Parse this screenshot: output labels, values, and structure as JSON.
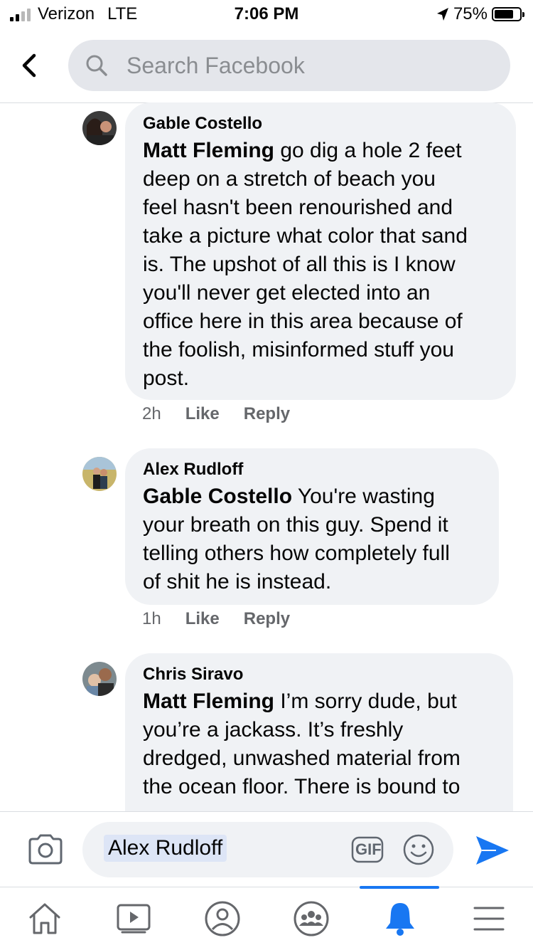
{
  "status_bar": {
    "carrier": "Verizon",
    "network": "LTE",
    "time": "7:06 PM",
    "battery": "75%",
    "battery_level": 0.75
  },
  "header": {
    "back_icon": "chevron-left-icon",
    "search_placeholder": "Search Facebook"
  },
  "comments": [
    {
      "author": "Gable Costello",
      "mention": "Matt Fleming",
      "text_lines": [
        " go dig a hole 2 feet",
        "deep on a stretch of beach you",
        "feel hasn't been renourished and",
        "take a picture what color that sand",
        "is.  The upshot of all this is I know",
        "you'll never get elected into an",
        "office here in this area because of",
        "the foolish, misinformed stuff you",
        "post."
      ],
      "time": "2h",
      "like": "Like",
      "reply": "Reply"
    },
    {
      "author": "Alex Rudloff",
      "mention": "Gable Costello",
      "text_lines": [
        " You're wasting",
        "your breath on this guy. Spend it",
        "telling others how completely full",
        "of shit he is instead."
      ],
      "time": "1h",
      "like": "Like",
      "reply": "Reply"
    },
    {
      "author": "Chris Siravo",
      "mention": "Matt Fleming",
      "text_lines": [
        " I’m sorry dude, but",
        "you’re a jackass. It’s freshly",
        "dredged, unwashed material from",
        "the ocean floor. There is bound to"
      ]
    }
  ],
  "composer": {
    "mention_tag": "Alex Rudloff",
    "gif_label": "GIF"
  },
  "tabbar": {
    "tabs": [
      "home-icon",
      "watch-icon",
      "profile-icon",
      "groups-icon",
      "notifications-icon",
      "menu-icon"
    ],
    "active": "notifications-icon"
  },
  "colors": {
    "accent": "#1877f2",
    "bubble": "#f0f2f5",
    "secondary_text": "#65676b"
  }
}
